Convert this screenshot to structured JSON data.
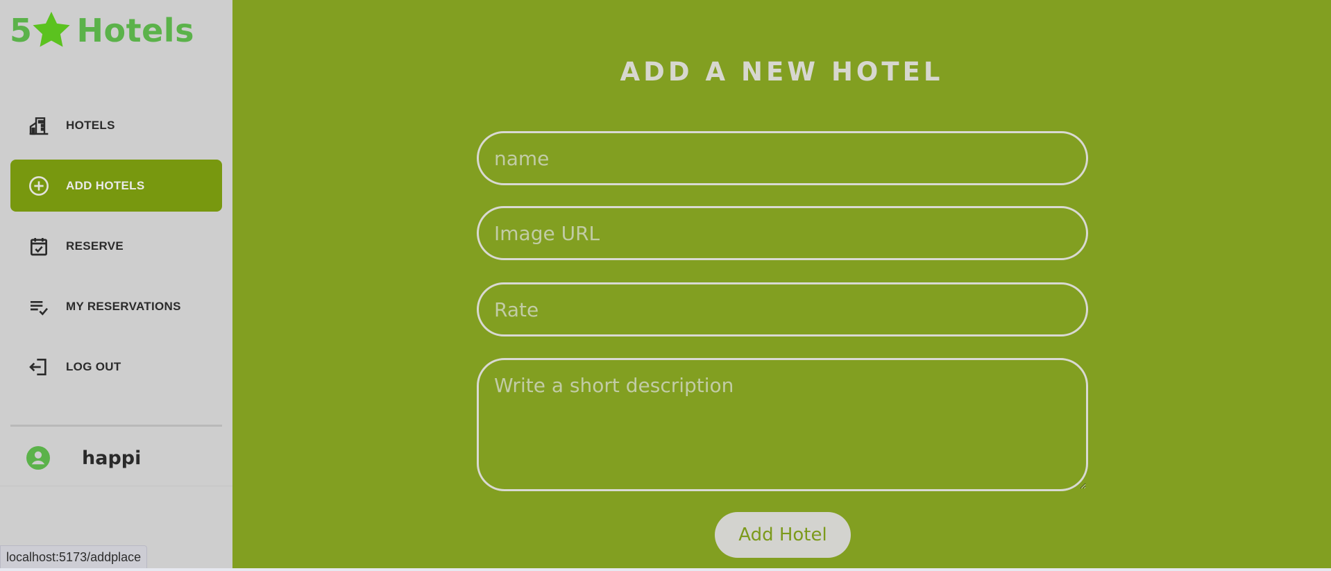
{
  "brand": {
    "prefix": "5",
    "name": "Hotels"
  },
  "sidebar": {
    "items": [
      {
        "label": "HOTELS",
        "icon": "building-icon",
        "active": false
      },
      {
        "label": "ADD HOTELS",
        "icon": "add-circle-icon",
        "active": true
      },
      {
        "label": "RESERVE",
        "icon": "calendar-check-icon",
        "active": false
      },
      {
        "label": "MY RESERVATIONS",
        "icon": "list-check-icon",
        "active": false
      },
      {
        "label": "LOG OUT",
        "icon": "logout-icon",
        "active": false
      }
    ],
    "user": {
      "name": "happi",
      "icon": "user-avatar-icon"
    }
  },
  "form": {
    "title": "ADD A NEW HOTEL",
    "name_placeholder": "name",
    "image_placeholder": "Image URL",
    "rate_placeholder": "Rate",
    "description_placeholder": "Write a short description",
    "submit_label": "Add Hotel"
  },
  "status_bar": {
    "url": "localhost:5173/addplace"
  },
  "colors": {
    "sidebar_bg": "#cecece",
    "main_bg": "#829f21",
    "active_item_bg": "#78980f",
    "brand_green": "#5bb24a"
  }
}
